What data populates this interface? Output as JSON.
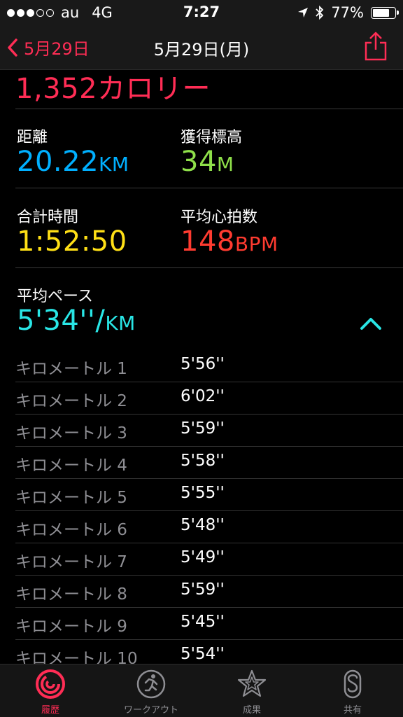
{
  "status": {
    "carrier": "au",
    "network": "4G",
    "time": "7:27",
    "battery": "77%",
    "battery_level": 0.77
  },
  "nav": {
    "back_label": "5月29日",
    "title": "5月29日(月)"
  },
  "calories": "1,352カロリー",
  "stats": {
    "distance": {
      "label": "距離",
      "value": "20.22",
      "unit": "KM"
    },
    "elevation": {
      "label": "獲得標高",
      "value": "34",
      "unit": "M"
    },
    "total_time": {
      "label": "合計時間",
      "value": "1:52:50"
    },
    "heart_rate": {
      "label": "平均心拍数",
      "value": "148",
      "unit": "BPM"
    },
    "pace": {
      "label": "平均ペース",
      "value": "5'34''/",
      "unit": "KM"
    }
  },
  "splits": [
    {
      "label": "キロメートル 1",
      "pace": "5'56''"
    },
    {
      "label": "キロメートル 2",
      "pace": "6'02''"
    },
    {
      "label": "キロメートル 3",
      "pace": "5'59''"
    },
    {
      "label": "キロメートル 4",
      "pace": "5'58''"
    },
    {
      "label": "キロメートル 5",
      "pace": "5'55''"
    },
    {
      "label": "キロメートル 6",
      "pace": "5'48''"
    },
    {
      "label": "キロメートル 7",
      "pace": "5'49''"
    },
    {
      "label": "キロメートル 8",
      "pace": "5'59''"
    },
    {
      "label": "キロメートル 9",
      "pace": "5'45''"
    },
    {
      "label": "キロメートル 10",
      "pace": "5'54''"
    }
  ],
  "tabs": [
    {
      "label": "履歴",
      "icon": "history-rings-icon",
      "active": true
    },
    {
      "label": "ワークアウト",
      "icon": "running-figure-icon",
      "active": false
    },
    {
      "label": "成果",
      "icon": "star-award-icon",
      "active": false
    },
    {
      "label": "共有",
      "icon": "sharing-s-icon",
      "active": false
    }
  ],
  "colors": {
    "accent": "#ff2d55",
    "distance": "#00b0ff",
    "elevation": "#8fe04a",
    "time": "#ffe016",
    "heart_rate": "#ff3b30",
    "pace": "#29e6e6"
  }
}
